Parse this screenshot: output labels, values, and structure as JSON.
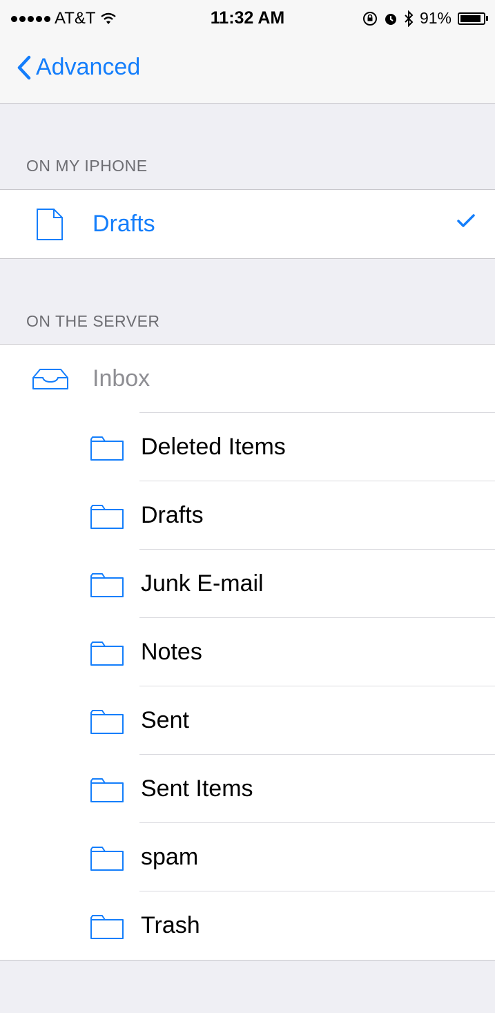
{
  "status_bar": {
    "carrier": "AT&T",
    "time": "11:32 AM",
    "battery_percent": "91%",
    "battery_level": 0.91,
    "icons": [
      "signal-dots-icon",
      "wifi-icon",
      "orientation-lock-icon",
      "alarm-icon",
      "bluetooth-icon",
      "battery-icon"
    ]
  },
  "nav": {
    "back_label": "Advanced"
  },
  "sections": {
    "on_my_iphone": {
      "header": "ON MY IPHONE",
      "drafts_label": "Drafts"
    },
    "on_the_server": {
      "header": "ON THE SERVER",
      "inbox_label": "Inbox",
      "folders": [
        "Deleted Items",
        "Drafts",
        "Junk E-mail",
        "Notes",
        "Sent",
        "Sent Items",
        "spam",
        "Trash"
      ]
    }
  },
  "colors": {
    "accent": "#147efb",
    "background": "#efeff4",
    "disabled_text": "#8e8e93"
  }
}
